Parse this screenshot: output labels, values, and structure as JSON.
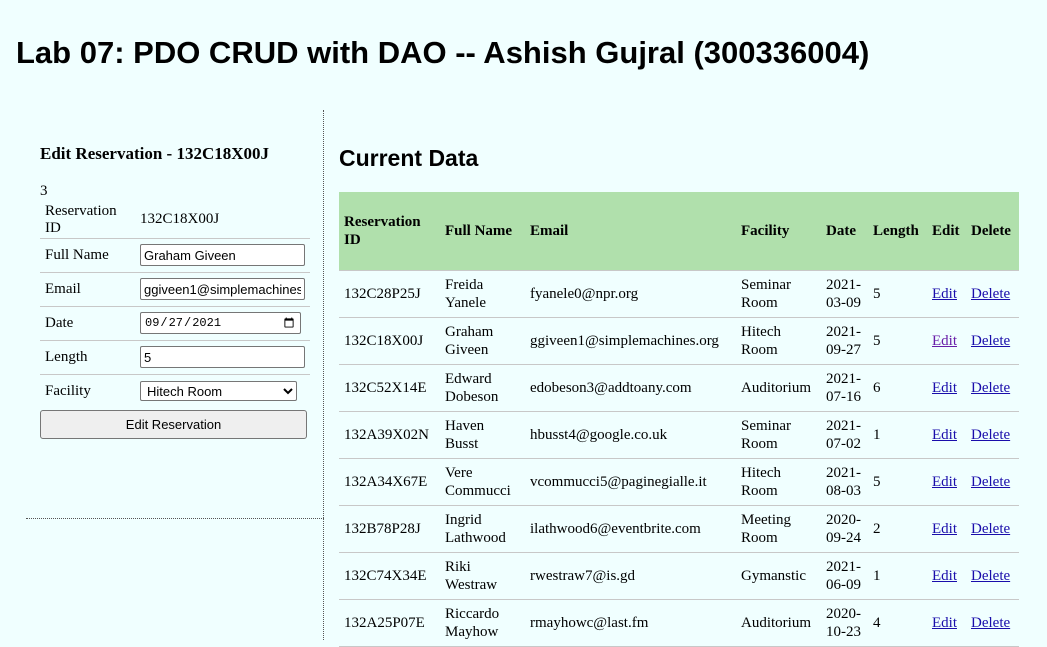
{
  "page": {
    "title": "Lab 07: PDO CRUD with DAO -- Ashish Gujral (300336004)"
  },
  "edit_form": {
    "heading": "Edit Reservation - 132C18X00J",
    "row_number": "3",
    "fields": {
      "reservation_id": {
        "label": "Reservation ID",
        "value": "132C18X00J"
      },
      "full_name": {
        "label": "Full Name",
        "value": "Graham Giveen"
      },
      "email": {
        "label": "Email",
        "value": "ggiveen1@simplemachines.org"
      },
      "date": {
        "label": "Date",
        "value": "2021-09-27"
      },
      "length": {
        "label": "Length",
        "value": "5"
      },
      "facility": {
        "label": "Facility",
        "selected": "Hitech Room"
      }
    },
    "submit_label": "Edit Reservation"
  },
  "current_data": {
    "heading": "Current Data",
    "columns": [
      "Reservation ID",
      "Full Name",
      "Email",
      "Facility",
      "Date",
      "Length",
      "Edit",
      "Delete"
    ],
    "rows": [
      {
        "id": "132C28P25J",
        "name": "Freida Yanele",
        "email": "fyanele0@npr.org",
        "facility": "Seminar Room",
        "date": "2021-03-09",
        "length": "5",
        "edit": "Edit",
        "delete": "Delete"
      },
      {
        "id": "132C18X00J",
        "name": "Graham Giveen",
        "email": "ggiveen1@simplemachines.org",
        "facility": "Hitech Room",
        "date": "2021-09-27",
        "length": "5",
        "edit": "Edit",
        "delete": "Delete"
      },
      {
        "id": "132C52X14E",
        "name": "Edward Dobeson",
        "email": "edobeson3@addtoany.com",
        "facility": "Auditorium",
        "date": "2021-07-16",
        "length": "6",
        "edit": "Edit",
        "delete": "Delete"
      },
      {
        "id": "132A39X02N",
        "name": "Haven Busst",
        "email": "hbusst4@google.co.uk",
        "facility": "Seminar Room",
        "date": "2021-07-02",
        "length": "1",
        "edit": "Edit",
        "delete": "Delete"
      },
      {
        "id": "132A34X67E",
        "name": "Vere Commucci",
        "email": "vcommucci5@paginegialle.it",
        "facility": "Hitech Room",
        "date": "2021-08-03",
        "length": "5",
        "edit": "Edit",
        "delete": "Delete"
      },
      {
        "id": "132B78P28J",
        "name": "Ingrid Lathwood",
        "email": "ilathwood6@eventbrite.com",
        "facility": "Meeting Room",
        "date": "2020-09-24",
        "length": "2",
        "edit": "Edit",
        "delete": "Delete"
      },
      {
        "id": "132C74X34E",
        "name": "Riki Westraw",
        "email": "rwestraw7@is.gd",
        "facility": "Gymanstic",
        "date": "2021-06-09",
        "length": "1",
        "edit": "Edit",
        "delete": "Delete"
      },
      {
        "id": "132A25P07E",
        "name": "Riccardo Mayhow",
        "email": "rmayhowc@last.fm",
        "facility": "Auditorium",
        "date": "2020-10-23",
        "length": "4",
        "edit": "Edit",
        "delete": "Delete"
      }
    ]
  },
  "colors": {
    "background": "#f0ffff",
    "header_row": "#b0e0ac",
    "link": "#1a0dab",
    "visited_link": "#681da8"
  }
}
